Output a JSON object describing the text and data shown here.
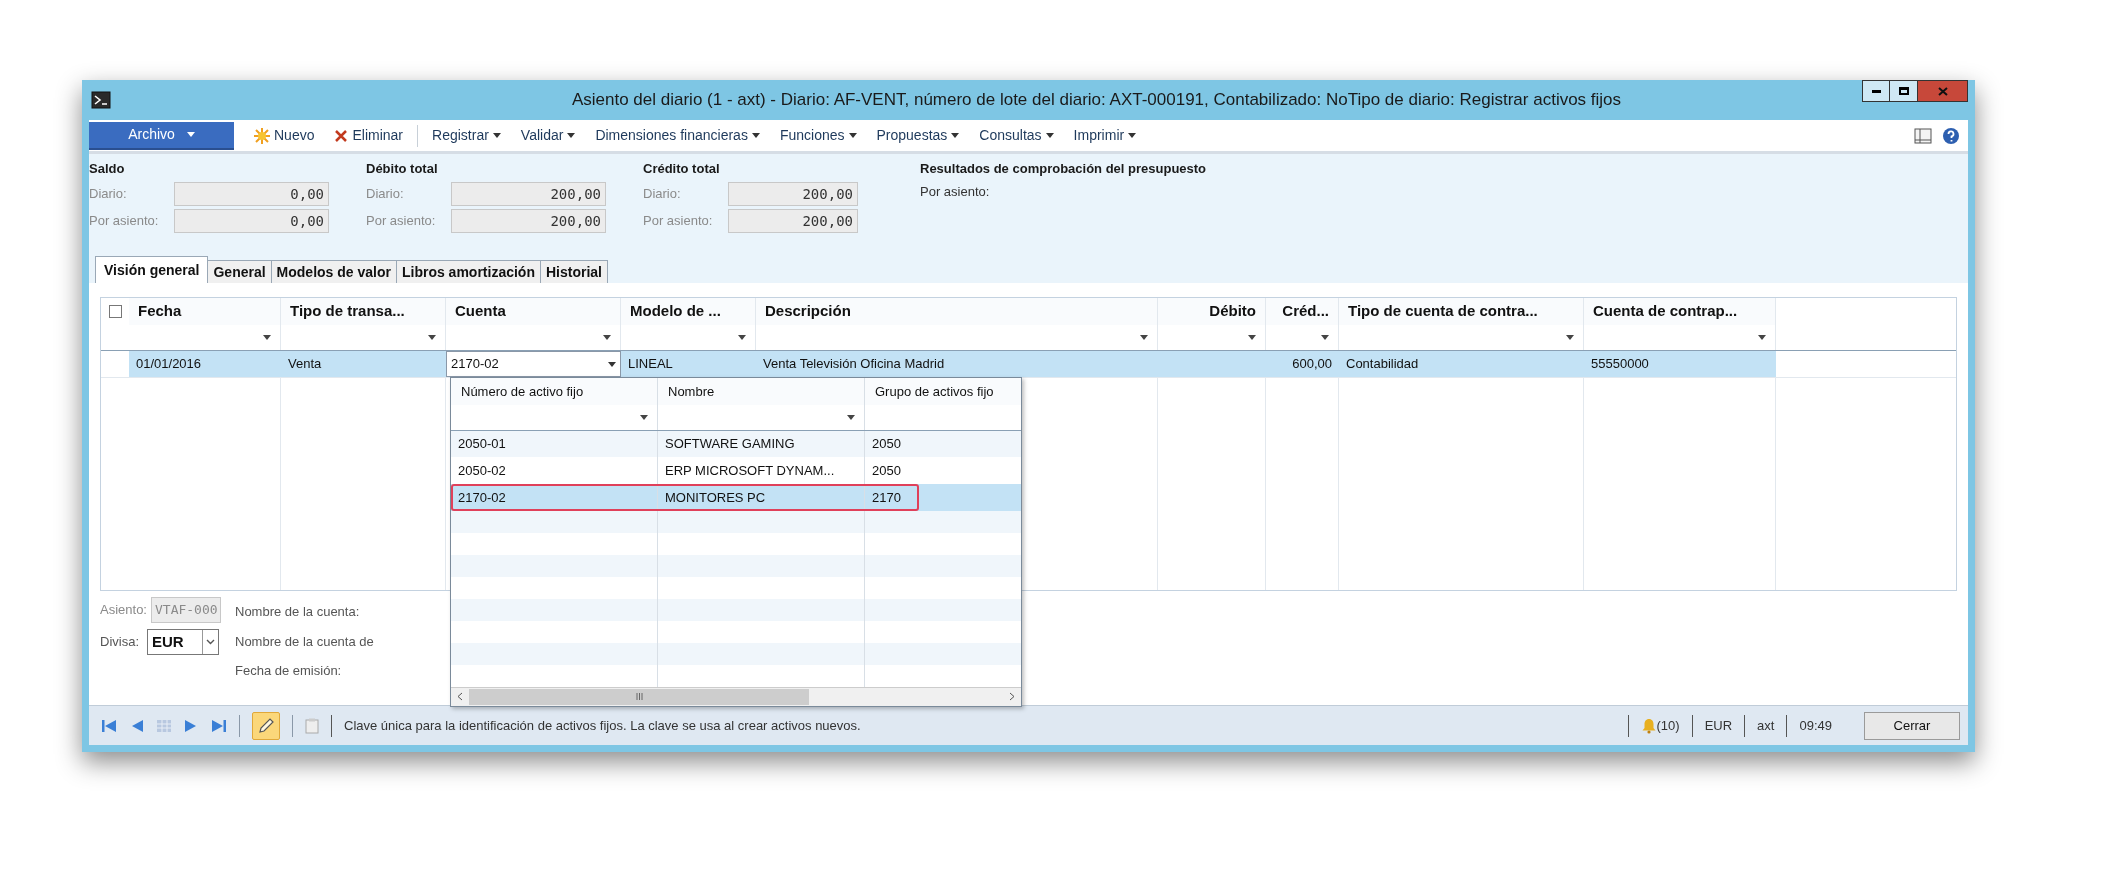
{
  "window": {
    "title": "Asiento del diario (1 - axt) - Diario: AF-VENT, número de lote del diario: AXT-000191, Contabilizado: NoTipo de diario: Registrar activos fijos"
  },
  "toolbar": {
    "file_menu": "Archivo",
    "items": [
      {
        "label": "Nuevo",
        "kind": "new"
      },
      {
        "label": "Eliminar",
        "kind": "delete"
      },
      {
        "label": "Registrar",
        "kind": "menu"
      },
      {
        "label": "Validar",
        "kind": "menu"
      },
      {
        "label": "Dimensiones financieras",
        "kind": "menu"
      },
      {
        "label": "Funciones",
        "kind": "menu"
      },
      {
        "label": "Propuestas",
        "kind": "menu"
      },
      {
        "label": "Consultas",
        "kind": "menu"
      },
      {
        "label": "Imprimir",
        "kind": "menu"
      }
    ]
  },
  "totals": [
    {
      "title": "Saldo",
      "rows": [
        {
          "label": "Diario:",
          "value": "0,00"
        },
        {
          "label": "Por asiento:",
          "value": "0,00"
        }
      ]
    },
    {
      "title": "Débito total",
      "rows": [
        {
          "label": "Diario:",
          "value": "200,00"
        },
        {
          "label": "Por asiento:",
          "value": "200,00"
        }
      ]
    },
    {
      "title": "Crédito total",
      "rows": [
        {
          "label": "Diario:",
          "value": "200,00"
        },
        {
          "label": "Por asiento:",
          "value": "200,00"
        }
      ]
    }
  ],
  "budget": {
    "title": "Resultados de comprobación del presupuesto",
    "label": "Por asiento:"
  },
  "tabs": [
    {
      "label": "Visión general",
      "selected": true
    },
    {
      "label": "General",
      "selected": false
    },
    {
      "label": "Modelos de valor",
      "selected": false
    },
    {
      "label": "Libros amortización",
      "selected": false
    },
    {
      "label": "Historial",
      "selected": false
    }
  ],
  "grid": {
    "select_all": {
      "checked": false
    },
    "columns": [
      {
        "label": "Fecha",
        "numeric": false
      },
      {
        "label": "Tipo de transa...",
        "numeric": false
      },
      {
        "label": "Cuenta",
        "numeric": false
      },
      {
        "label": "Modelo de ...",
        "numeric": false
      },
      {
        "label": "Descripción",
        "numeric": false
      },
      {
        "label": "Débito",
        "numeric": true
      },
      {
        "label": "Créd...",
        "numeric": true
      },
      {
        "label": "Tipo de cuenta de contra...",
        "numeric": false
      },
      {
        "label": "Cuenta de contrap...",
        "numeric": false
      }
    ],
    "rows": [
      {
        "selected": true,
        "cells": [
          {
            "kind": "text",
            "text": "01/01/2016"
          },
          {
            "kind": "text",
            "text": "Venta"
          },
          {
            "kind": "combo",
            "text": "2170-02"
          },
          {
            "kind": "text",
            "text": "LINEAL"
          },
          {
            "kind": "text",
            "text": "Venta Televisión Oficina Madrid"
          },
          {
            "kind": "empty"
          },
          {
            "kind": "number",
            "text": "600,00"
          },
          {
            "kind": "text",
            "text": "Contabilidad"
          },
          {
            "kind": "text",
            "text": "55550000"
          }
        ]
      }
    ]
  },
  "lookup": {
    "columns": [
      "Número de activo fijo",
      "Nombre",
      "Grupo de activos fijo"
    ],
    "rows": [
      {
        "selected": false,
        "outlined": false,
        "cells": [
          "2050-01",
          "SOFTWARE GAMING",
          "2050"
        ]
      },
      {
        "selected": false,
        "outlined": false,
        "cells": [
          "2050-02",
          "ERP MICROSOFT DYNAM...",
          "2050"
        ]
      },
      {
        "selected": true,
        "outlined": true,
        "cells": [
          "2170-02",
          "MONITORES PC",
          "2170"
        ]
      }
    ]
  },
  "details": {
    "voucher": {
      "label": "Asiento:",
      "value": "VTAF-000"
    },
    "currency": {
      "label": "Divisa:",
      "value": "EUR"
    },
    "labels": [
      "Nombre de la cuenta:",
      "Nombre de la cuenta de",
      "Fecha de emisión:"
    ]
  },
  "status_bar": {
    "edit_mode": true,
    "message": "Clave única para la identificación de activos fijos. La clave se usa al crear activos nuevos.",
    "alerts": "(10)",
    "currency": "EUR",
    "company": "axt",
    "time": "09:49",
    "close_button": "Cerrar"
  }
}
